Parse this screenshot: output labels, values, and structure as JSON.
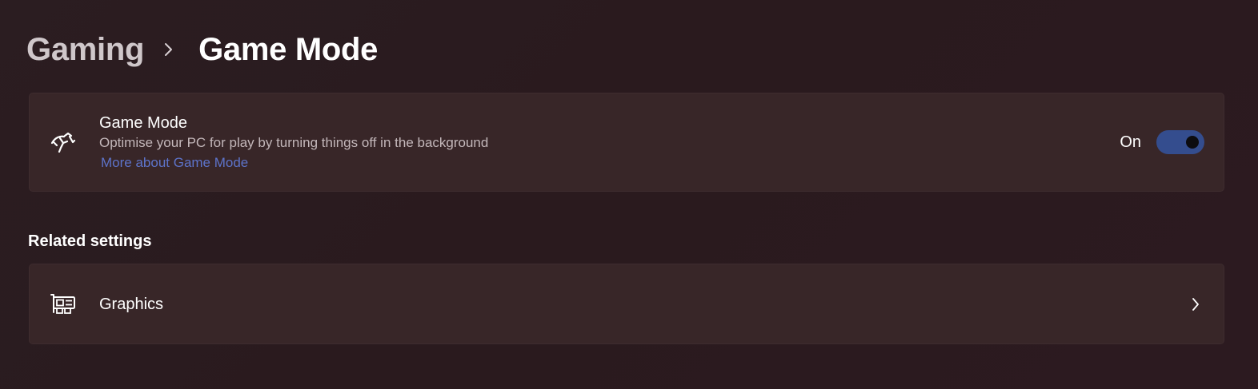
{
  "breadcrumb": {
    "parent": "Gaming",
    "separator_icon": "chevron-right-icon",
    "current": "Game Mode"
  },
  "game_mode_card": {
    "icon": "game-mode-icon",
    "title": "Game Mode",
    "description": "Optimise your PC for play by turning things off in the background",
    "link": "More about Game Mode",
    "toggle_label": "On",
    "toggle_state": true,
    "accent_color": "#344d8e",
    "link_color": "#5d73c9"
  },
  "related_settings": {
    "heading": "Related settings",
    "items": [
      {
        "icon": "graphics-card-icon",
        "label": "Graphics",
        "chevron_icon": "chevron-right-icon"
      }
    ]
  }
}
